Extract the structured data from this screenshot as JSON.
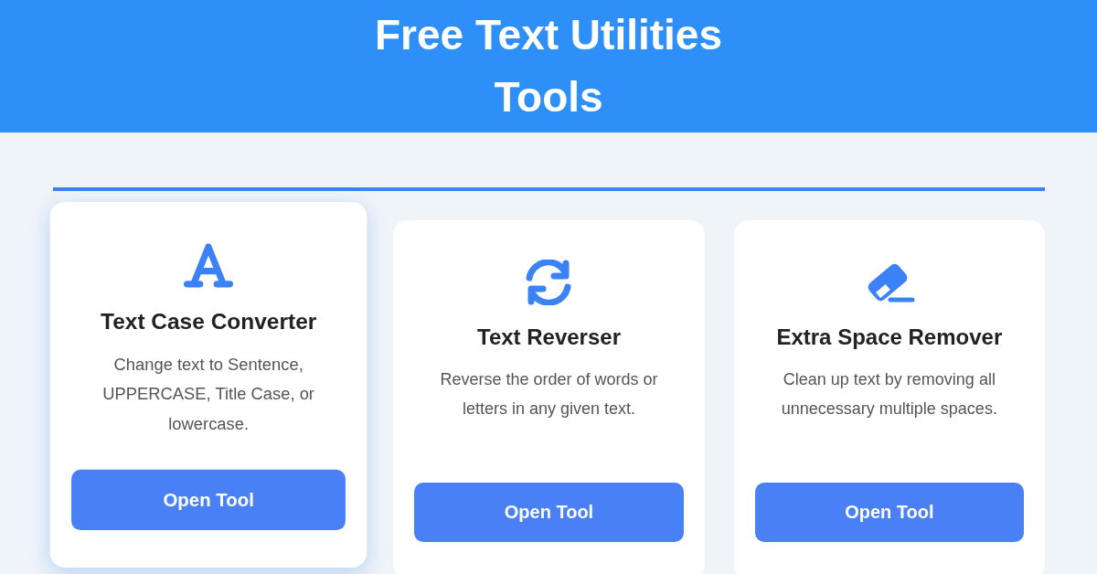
{
  "header": {
    "title": "Free Text Utilities Tools"
  },
  "cards": [
    {
      "kind": "case",
      "title": "Text Case Converter",
      "description": "Change text to Sentence, UPPERCASE, Title Case, or lowercase.",
      "button": "Open Tool",
      "hovered": true
    },
    {
      "kind": "reverse",
      "title": "Text Reverser",
      "description": "Reverse the order of words or letters in any given text.",
      "button": "Open Tool",
      "hovered": false
    },
    {
      "kind": "eraser",
      "title": "Extra Space Remover",
      "description": "Clean up text by removing all unnecessary multiple spaces.",
      "button": "Open Tool",
      "hovered": false
    }
  ]
}
